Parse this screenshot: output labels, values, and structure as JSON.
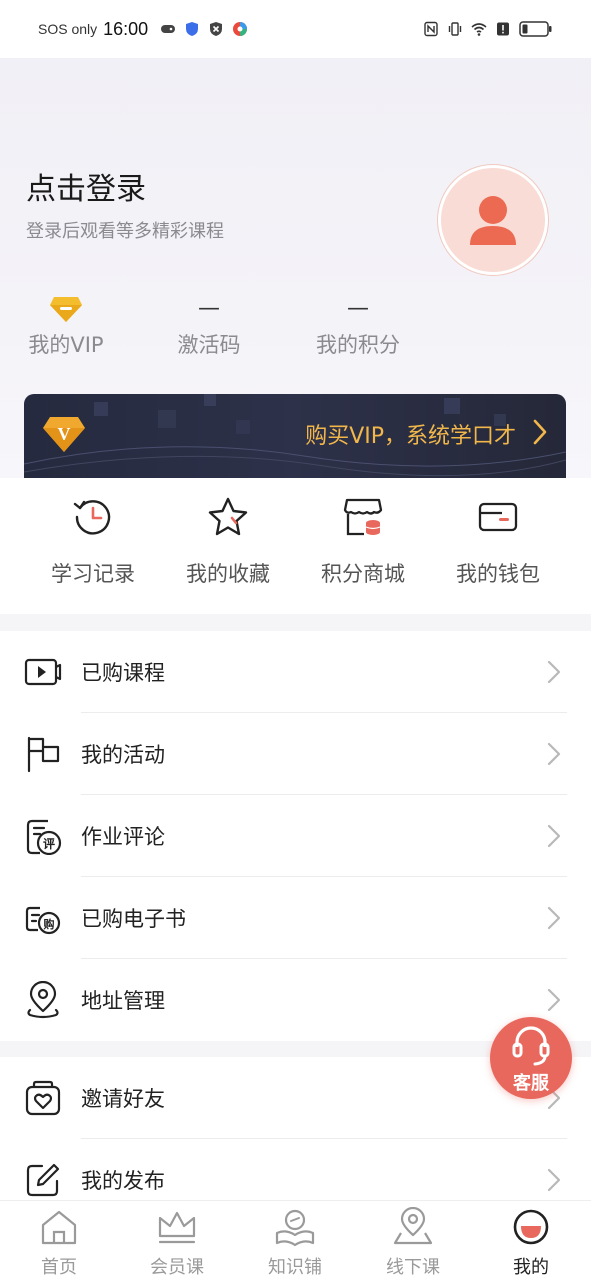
{
  "status_bar": {
    "sos": "SOS only",
    "time": "16:00"
  },
  "profile": {
    "title": "点击登录",
    "subtitle": "登录后观看等多精彩课程"
  },
  "stats": [
    {
      "value": "",
      "label": "我的VIP"
    },
    {
      "value": "—",
      "label": "激活码"
    },
    {
      "value": "—",
      "label": "我的积分"
    }
  ],
  "vip_banner": {
    "badge": "V",
    "text": "购买VIP，系统学口才"
  },
  "quick_actions": [
    {
      "label": "学习记录",
      "icon": "history-clock-icon"
    },
    {
      "label": "我的收藏",
      "icon": "star-icon"
    },
    {
      "label": "积分商城",
      "icon": "store-icon"
    },
    {
      "label": "我的钱包",
      "icon": "wallet-icon"
    }
  ],
  "menu_group1": [
    {
      "label": "已购课程",
      "icon": "video-course-icon"
    },
    {
      "label": "我的活动",
      "icon": "flag-icon"
    },
    {
      "label": "作业评论",
      "icon": "homework-comment-icon",
      "icon_text": "评"
    },
    {
      "label": "已购电子书",
      "icon": "ebook-icon",
      "icon_text": "购"
    },
    {
      "label": "地址管理",
      "icon": "location-pin-icon"
    }
  ],
  "menu_group2": [
    {
      "label": "邀请好友",
      "icon": "invite-heart-icon"
    },
    {
      "label": "我的发布",
      "icon": "edit-post-icon"
    }
  ],
  "customer_service": {
    "label": "客服"
  },
  "tabs": [
    {
      "label": "首页",
      "icon": "home-icon",
      "active": false
    },
    {
      "label": "会员课",
      "icon": "crown-icon",
      "active": false
    },
    {
      "label": "知识铺",
      "icon": "book-icon",
      "active": false
    },
    {
      "label": "线下课",
      "icon": "map-pin-icon",
      "active": false
    },
    {
      "label": "我的",
      "icon": "profile-face-icon",
      "active": true
    }
  ],
  "colors": {
    "accent": "#e8685d",
    "vip_gold": "#f2b74a",
    "banner_bg": "#2a2e44"
  }
}
